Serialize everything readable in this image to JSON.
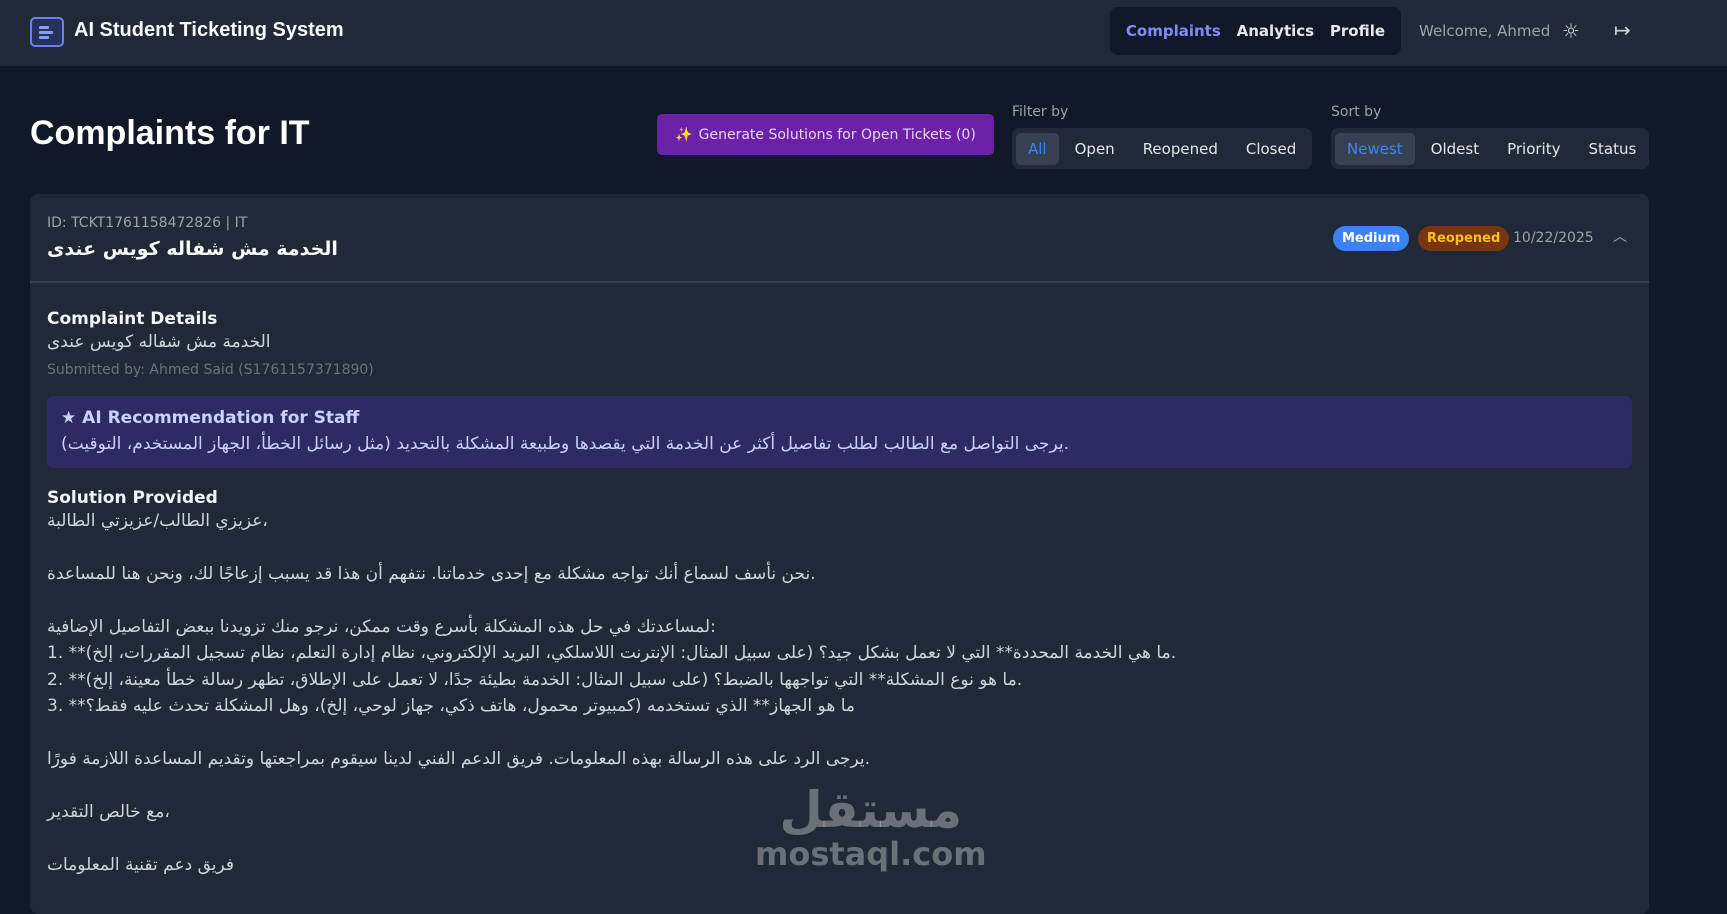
{
  "header": {
    "app_title": "AI Student Ticketing System",
    "nav": [
      {
        "label": "Complaints",
        "active": true
      },
      {
        "label": "Analytics",
        "active": false
      },
      {
        "label": "Profile",
        "active": false
      }
    ],
    "welcome": "Welcome, Ahmed",
    "icons": {
      "logo": "list-icon",
      "theme": "sun-icon",
      "logout": "logout-icon"
    }
  },
  "page": {
    "title": "Complaints for IT",
    "generate_button": "Generate Solutions for Open Tickets (0)",
    "filter_label": "Filter by",
    "filters": [
      "All",
      "Open",
      "Reopened",
      "Closed"
    ],
    "active_filter": "All",
    "sort_label": "Sort by",
    "sorts": [
      "Newest",
      "Oldest",
      "Priority",
      "Status"
    ],
    "active_sort": "Newest"
  },
  "ticket": {
    "id_line": "ID: TCKT1761158472826 | IT",
    "subject": "الخدمة مش شفاله كويس عندى",
    "priority": "Medium",
    "status": "Reopened",
    "date": "10/22/2025",
    "details_title": "Complaint Details",
    "details_text": "الخدمة مش شفاله كويس عندى",
    "submitted_by": "Submitted by: Ahmed Said (S1761157371890)",
    "ai_title": "AI Recommendation for Staff",
    "ai_text": "يرجى التواصل مع الطالب لطلب تفاصيل أكثر عن الخدمة التي يقصدها وطبيعة المشكلة بالتحديد (مثل رسائل الخطأ، الجهاز المستخدم، التوقيت).",
    "solution_title": "Solution Provided",
    "solution_lines": [
      "عزيزي الطالب/عزيزتي الطالبة،",
      "",
      "نحن نأسف لسماع أنك تواجه مشكلة مع إحدى خدماتنا. نتفهم أن هذا قد يسبب إزعاجًا لك، ونحن هنا للمساعدة.",
      "",
      "لمساعدتك في حل هذه المشكلة بأسرع وقت ممكن، نرجو منك تزويدنا ببعض التفاصيل الإضافية:",
      "1.  **ما هي الخدمة المحددة** التي لا تعمل بشكل جيد؟ (على سبيل المثال: الإنترنت اللاسلكي، البريد الإلكتروني، نظام إدارة التعلم، نظام تسجيل المقررات، إلخ).",
      "2.  **ما هو نوع المشكلة** التي تواجهها بالضبط؟ (على سبيل المثال: الخدمة بطيئة جدًا، لا تعمل على الإطلاق، تظهر رسالة خطأ معينة، إلخ).",
      "3.  **ما هو الجهاز** الذي تستخدمه (كمبيوتر محمول، هاتف ذكي، جهاز لوحي، إلخ)، وهل المشكلة تحدث عليه فقط؟",
      "",
      "يرجى الرد على هذه الرسالة بهذه المعلومات. فريق الدعم الفني لدينا سيقوم بمراجعتها وتقديم المساعدة اللازمة فورًا.",
      "",
      "مع خالص التقدير،",
      "",
      "فريق دعم تقنية المعلومات"
    ]
  },
  "watermark": {
    "arabic": "مستقل",
    "latin": "mostaql.com"
  }
}
